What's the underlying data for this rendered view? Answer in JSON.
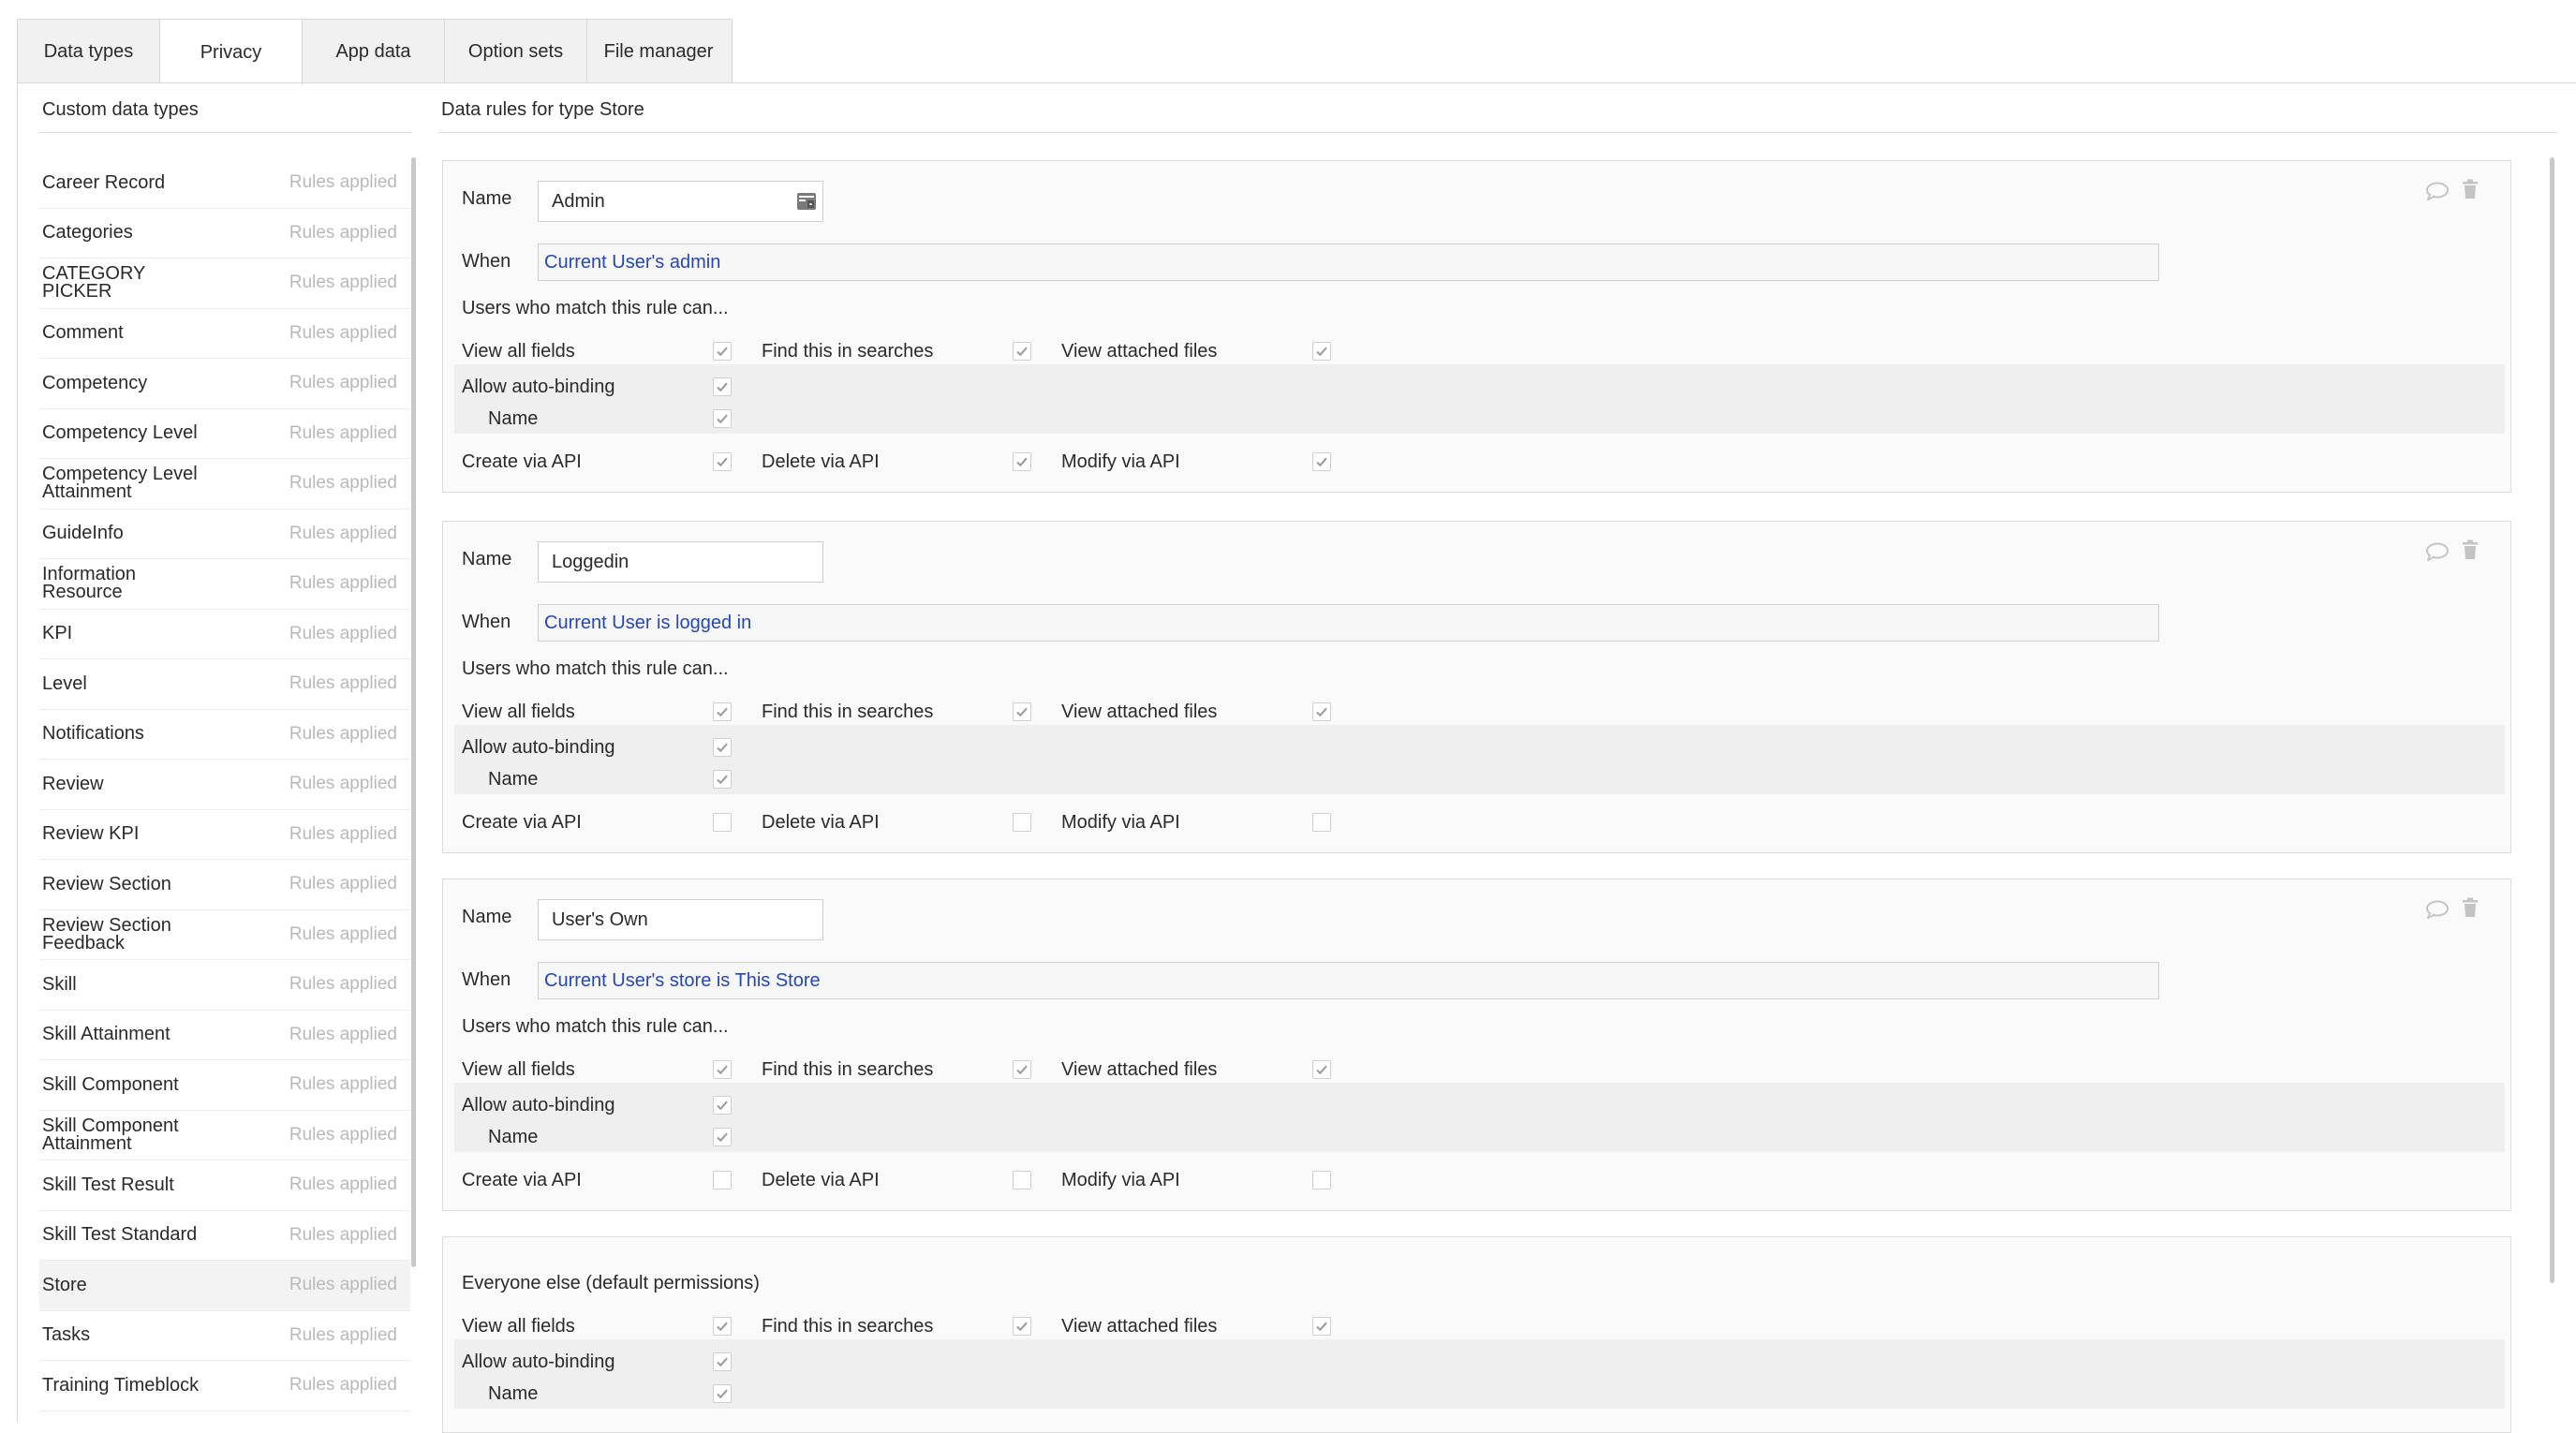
{
  "tabs": [
    {
      "label": "Data types",
      "active": false
    },
    {
      "label": "Privacy",
      "active": true
    },
    {
      "label": "App data",
      "active": false
    },
    {
      "label": "Option sets",
      "active": false
    },
    {
      "label": "File manager",
      "active": false
    }
  ],
  "sidebar": {
    "title": "Custom data types",
    "items": [
      {
        "name": "Career Record",
        "status": "Rules applied"
      },
      {
        "name": "Categories",
        "status": "Rules applied"
      },
      {
        "name": "CATEGORY PICKER",
        "status": "Rules applied"
      },
      {
        "name": "Comment",
        "status": "Rules applied"
      },
      {
        "name": "Competency",
        "status": "Rules applied"
      },
      {
        "name": "Competency Level",
        "status": "Rules applied"
      },
      {
        "name": "Competency Level Attainment",
        "status": "Rules applied"
      },
      {
        "name": "GuideInfo",
        "status": "Rules applied"
      },
      {
        "name": "Information Resource",
        "status": "Rules applied"
      },
      {
        "name": "KPI",
        "status": "Rules applied"
      },
      {
        "name": "Level",
        "status": "Rules applied"
      },
      {
        "name": "Notifications",
        "status": "Rules applied"
      },
      {
        "name": "Review",
        "status": "Rules applied"
      },
      {
        "name": "Review KPI",
        "status": "Rules applied"
      },
      {
        "name": "Review Section",
        "status": "Rules applied"
      },
      {
        "name": "Review Section Feedback",
        "status": "Rules applied"
      },
      {
        "name": "Skill",
        "status": "Rules applied"
      },
      {
        "name": "Skill Attainment",
        "status": "Rules applied"
      },
      {
        "name": "Skill Component",
        "status": "Rules applied"
      },
      {
        "name": "Skill Component Attainment",
        "status": "Rules applied"
      },
      {
        "name": "Skill Test Result",
        "status": "Rules applied"
      },
      {
        "name": "Skill Test Standard",
        "status": "Rules applied"
      },
      {
        "name": "Store",
        "status": "Rules applied",
        "selected": true
      },
      {
        "name": "Tasks",
        "status": "Rules applied"
      },
      {
        "name": "Training Timeblock",
        "status": "Rules applied"
      }
    ]
  },
  "main": {
    "title": "Data rules for type Store",
    "labels": {
      "name": "Name",
      "when": "When",
      "users_match": "Users who match this rule can...",
      "view_all_fields": "View all fields",
      "find_in_searches": "Find this in searches",
      "view_attached_files": "View attached files",
      "allow_auto_binding": "Allow auto-binding",
      "auto_binding_field": "Name",
      "create_via_api": "Create via API",
      "delete_via_api": "Delete via API",
      "modify_via_api": "Modify via API"
    },
    "rules": [
      {
        "name": "Admin",
        "when": "Current User's admin",
        "perms": {
          "view_all_fields": true,
          "find_in_searches": true,
          "view_attached_files": true,
          "allow_auto_binding": true,
          "auto_binding_name": true,
          "create_via_api": true,
          "delete_via_api": true,
          "modify_via_api": true
        }
      },
      {
        "name": "Loggedin",
        "when": "Current User is logged in",
        "perms": {
          "view_all_fields": true,
          "find_in_searches": true,
          "view_attached_files": true,
          "allow_auto_binding": true,
          "auto_binding_name": true,
          "create_via_api": false,
          "delete_via_api": false,
          "modify_via_api": false
        }
      },
      {
        "name": "User's Own",
        "when": "Current User's store is This Store",
        "perms": {
          "view_all_fields": true,
          "find_in_searches": true,
          "view_attached_files": true,
          "allow_auto_binding": true,
          "auto_binding_name": true,
          "create_via_api": false,
          "delete_via_api": false,
          "modify_via_api": false
        }
      }
    ],
    "default": {
      "title": "Everyone else (default permissions)",
      "perms": {
        "view_all_fields": true,
        "find_in_searches": true,
        "view_attached_files": true,
        "allow_auto_binding": true,
        "auto_binding_name": true
      }
    }
  },
  "colors": {
    "link_blue": "#2547b5",
    "muted_status": "#b9b9b9",
    "check_grey": "#9a9a9a"
  }
}
